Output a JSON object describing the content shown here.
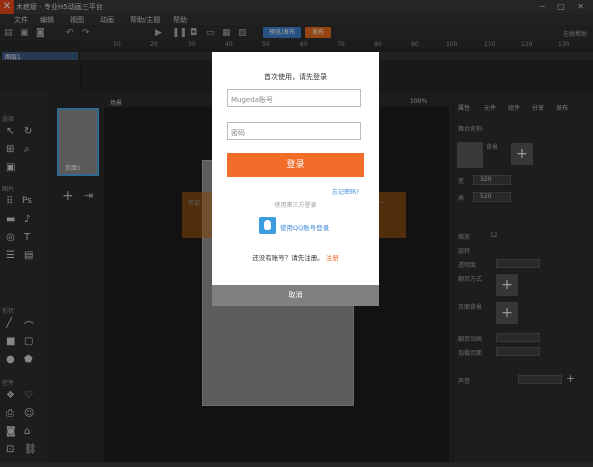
{
  "app": {
    "title": "木疙瘩 - 专业H5动画三平台",
    "window_controls": "─ □ ✕"
  },
  "menu": [
    "文件",
    "编辑",
    "视图",
    "动画",
    "帮助/主题",
    "帮助"
  ],
  "toolbar": {
    "preview_label": "预览/发布",
    "publish_label": "发布",
    "right_label": "在线帮助"
  },
  "timeline": {
    "ticks": [
      "10",
      "20",
      "30",
      "40",
      "50",
      "60",
      "70",
      "80",
      "90",
      "100",
      "110",
      "120",
      "130"
    ],
    "layer_name": "图层1"
  },
  "left_panel": {
    "sections": [
      "选择",
      "图片",
      "形状",
      "控件"
    ]
  },
  "pages_panel": {
    "page_label": "页面1"
  },
  "canvas": {
    "tab": "场景",
    "zoom": "100%",
    "behind_text_left": "欢迎",
    "behind_text_right": "一"
  },
  "right_panel": {
    "tabs": [
      "属性",
      "元件",
      "组件",
      "分享",
      "发布"
    ],
    "labels": [
      "舞台名称:",
      "背景",
      "宽",
      "高",
      "缩放",
      "旋转",
      "透明度",
      "翻页方式",
      "页面背景",
      "翻页动画",
      "加载页面",
      "声音",
      "音乐"
    ],
    "values": [
      "320",
      "520",
      "12",
      "100"
    ]
  },
  "modal": {
    "title": "首次使用，请先登录",
    "username_placeholder": "Mugeda账号",
    "password_placeholder": "密码",
    "login_label": "登录",
    "forgot_label": "忘记密码?",
    "third_party_label": "使用第三方登录",
    "qq_label": "使用QQ账号登录",
    "register_text": "还没有账号？请先注册。",
    "register_link": "注册",
    "cancel_label": "取消"
  }
}
